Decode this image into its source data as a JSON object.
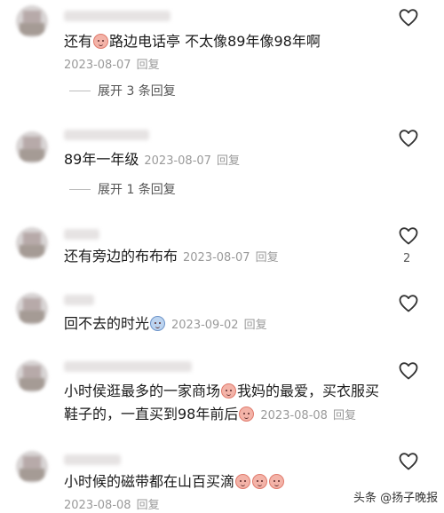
{
  "comments": [
    {
      "text_before": "还有",
      "text_after": "路边电话亭 不太像89年像98年啊",
      "date": "2023-08-07",
      "reply": "回复",
      "expand": "展开 3 条回复"
    },
    {
      "text": "89年一年级",
      "date": "2023-08-07",
      "reply": "回复",
      "expand": "展开 1 条回复"
    },
    {
      "text": "还有旁边的布布布",
      "date": "2023-08-07",
      "reply": "回复",
      "likes": "2"
    },
    {
      "text": "回不去的时光",
      "date": "2023-09-02",
      "reply": "回复"
    },
    {
      "line1_a": "小时侯逛最多的一家商场",
      "line1_b": "我妈的最爱，买衣服买",
      "line2": "鞋子的，一直买到98年前后",
      "date": "2023-08-08",
      "reply": "回复"
    },
    {
      "text": "小时候的磁带都在山百买滴",
      "date": "2023-08-08",
      "reply": "回复"
    }
  ],
  "watermark": "头条 @扬子晚报",
  "icons": {
    "like": "heart-outline-icon",
    "emoji": "smiling-face-emoji-icon"
  },
  "colors": {
    "meta": "#9a9a9a",
    "text": "#1a1a1a"
  }
}
